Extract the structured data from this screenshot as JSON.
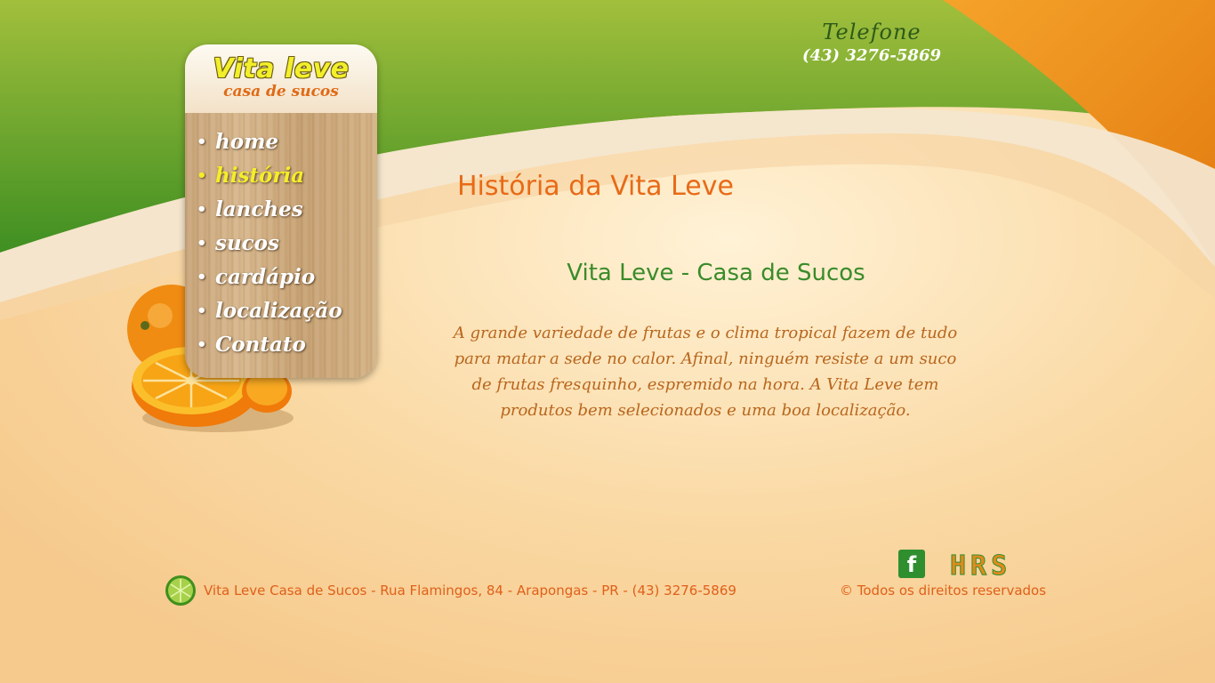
{
  "header": {
    "phone_label": "Telefone",
    "phone_number": "(43) 3276-5869"
  },
  "brand": {
    "name": "Vita leve",
    "tagline": "casa de sucos"
  },
  "menu": {
    "items": [
      {
        "label": "home",
        "active": false
      },
      {
        "label": "história",
        "active": true
      },
      {
        "label": "lanches",
        "active": false
      },
      {
        "label": "sucos",
        "active": false
      },
      {
        "label": "cardápio",
        "active": false
      },
      {
        "label": "localização",
        "active": false
      },
      {
        "label": "Contato",
        "active": false
      }
    ],
    "bullet": "•"
  },
  "main": {
    "title": "História da Vita Leve",
    "subtitle": "Vita Leve - Casa de Sucos",
    "paragraph_lines": [
      "A grande variedade de frutas e o clima tropical fazem de tudo",
      "para matar a sede no calor. Afinal, ninguém resiste a um suco",
      "de frutas fresquinho, espremido na hora. A Vita Leve tem",
      "produtos bem selecionados e uma boa localização."
    ]
  },
  "footer": {
    "address": "Vita Leve Casa de Sucos - Rua Flamingos, 84 - Arapongas - PR - (43) 3276-5869",
    "facebook_glyph": "f",
    "hrs_logo": "HRS",
    "copyright": "© Todos os direitos reservados"
  },
  "colors": {
    "green": "#4e9a26",
    "orange": "#f08a1a",
    "accent_yellow": "#f4ee2a",
    "title_orange": "#e86a17",
    "subtitle_green": "#3a8b2a"
  }
}
